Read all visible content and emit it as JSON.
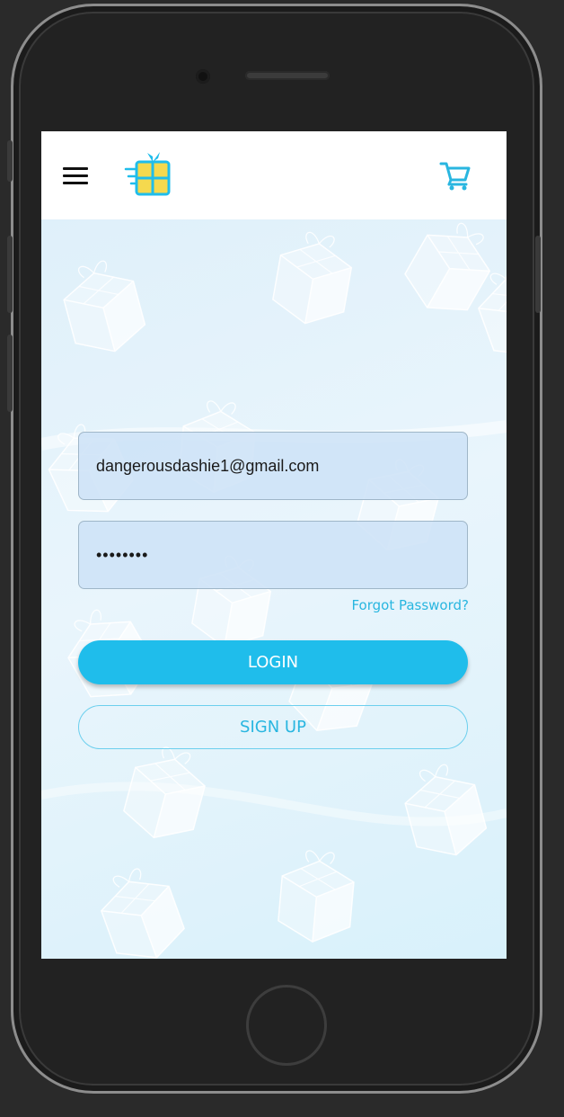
{
  "header": {
    "menu_icon": "hamburger-menu-icon",
    "logo_icon": "gift-box-logo-icon",
    "cart_icon": "shopping-cart-icon"
  },
  "login_form": {
    "email_value": "dangerousdashie1@gmail.com",
    "password_value": "••••••••",
    "forgot_password_label": "Forgot Password?",
    "login_label": "LOGIN",
    "signup_label": "SIGN UP"
  },
  "colors": {
    "accent": "#1fbdeb",
    "link": "#29b6e0",
    "logo_yellow": "#f5d94e",
    "logo_blue": "#1fbdeb"
  }
}
